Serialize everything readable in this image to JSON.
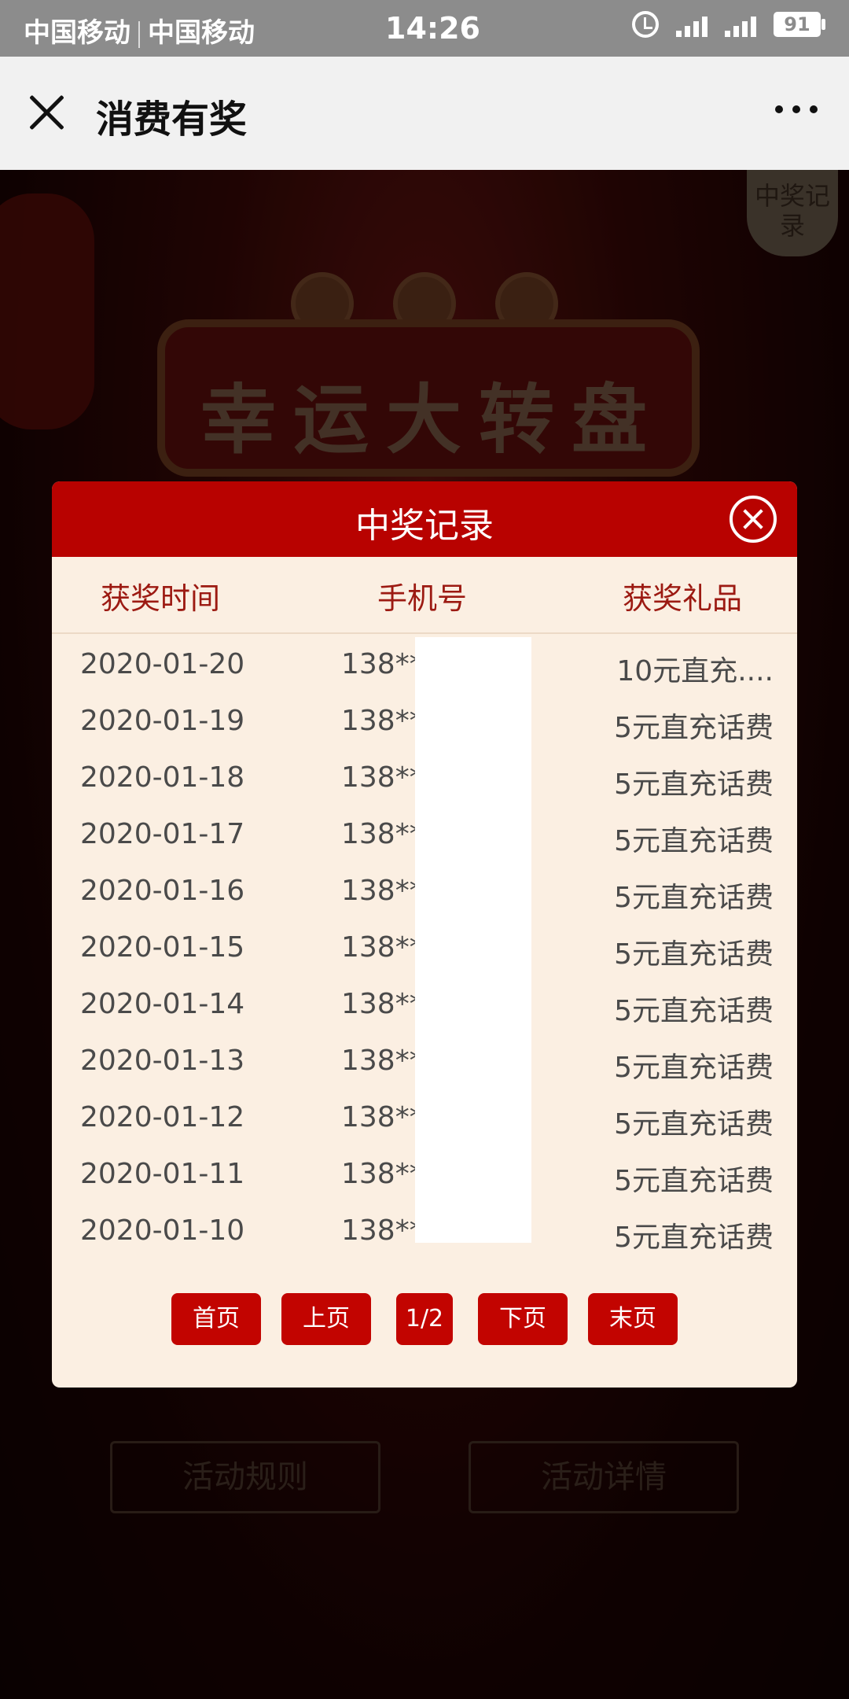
{
  "status_bar": {
    "carrier_1": "中国移动",
    "carrier_2": "中国移动",
    "time": "14:26",
    "network": "4G",
    "battery": "91"
  },
  "navbar": {
    "title": "消费有奖"
  },
  "background": {
    "banner_text": "幸运大转盘",
    "record_badge": "中奖记录",
    "rules_button": "活动规则",
    "details_button": "活动详情"
  },
  "modal": {
    "title": "中奖记录",
    "columns": {
      "time": "获奖时间",
      "phone": "手机号",
      "prize": "获奖礼品"
    },
    "rows": [
      {
        "date": "2020-01-20",
        "phone": "138**",
        "prize": "10元直充...."
      },
      {
        "date": "2020-01-19",
        "phone": "138**",
        "prize": "5元直充话费"
      },
      {
        "date": "2020-01-18",
        "phone": "138**",
        "prize": "5元直充话费"
      },
      {
        "date": "2020-01-17",
        "phone": "138**",
        "prize": "5元直充话费"
      },
      {
        "date": "2020-01-16",
        "phone": "138**",
        "prize": "5元直充话费"
      },
      {
        "date": "2020-01-15",
        "phone": "138**",
        "prize": "5元直充话费"
      },
      {
        "date": "2020-01-14",
        "phone": "138**",
        "prize": "5元直充话费"
      },
      {
        "date": "2020-01-13",
        "phone": "138**",
        "prize": "5元直充话费"
      },
      {
        "date": "2020-01-12",
        "phone": "138**",
        "prize": "5元直充话费"
      },
      {
        "date": "2020-01-11",
        "phone": "138**",
        "prize": "5元直充话费"
      },
      {
        "date": "2020-01-10",
        "phone": "138**",
        "prize": "5元直充话费"
      }
    ],
    "pager": {
      "first": "首页",
      "prev": "上页",
      "page": "1/2",
      "next": "下页",
      "last": "末页"
    }
  },
  "colors": {
    "header_red": "#b80200",
    "button_red": "#c20400",
    "modal_bg": "#fbefe2",
    "column_text": "#9c1a12"
  }
}
